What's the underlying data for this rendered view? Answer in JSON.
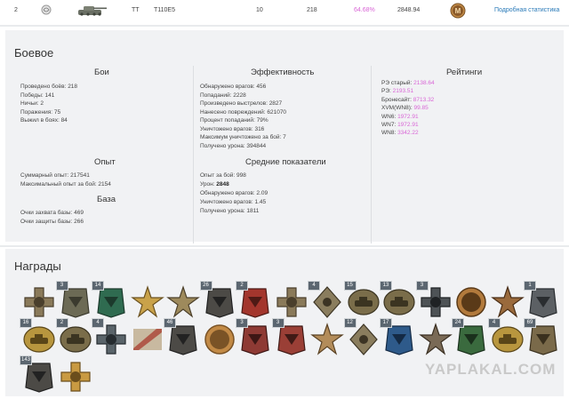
{
  "vehicle_row": {
    "index": "2",
    "tank_class": "ТТ",
    "tank_name": "T110E5",
    "level": "10",
    "battles": "218",
    "win_percent": "64.68%",
    "rating": "2848.94",
    "link_label": "Подробная статистика",
    "colors": {
      "win_percent": "#d966d6",
      "link": "#2a7ab8"
    }
  },
  "stats": {
    "title": "Боевое",
    "battles": {
      "heading": "Бои",
      "lines": [
        "Проведено боёв: 218",
        "Победы: 141",
        "Ничьи: 2",
        "Поражения: 75",
        "Выжил в боях: 84"
      ]
    },
    "efficiency": {
      "heading": "Эффективность",
      "lines": [
        "Обнаружено врагов: 456",
        "Попаданий: 2228",
        "Произведено выстрелов: 2827",
        "Нанесено повреждений: 621070",
        "Процент попаданий: 79%",
        "Уничтожено врагов: 316",
        "Максимум уничтожено за бой: 7",
        "Получено урона: 394844"
      ]
    },
    "ratings": {
      "heading": "Рейтинги",
      "items": [
        {
          "label": "РЭ старый:",
          "value": "2138.64"
        },
        {
          "label": "РЭ:",
          "value": "2193.51"
        },
        {
          "label": "Бронесайт:",
          "value": "8713.32"
        },
        {
          "label": "XVM(WN8):",
          "value": "99.85"
        },
        {
          "label": "WN6:",
          "value": "1972.91"
        },
        {
          "label": "WN7:",
          "value": "1972.91"
        },
        {
          "label": "WN8:",
          "value": "3342.22"
        }
      ],
      "value_color": "#d966d6"
    },
    "experience": {
      "heading": "Опыт",
      "lines": [
        "Суммарный опыт: 217541",
        "Максимальный опыт за бой: 2154"
      ]
    },
    "averages": {
      "heading": "Средние показатели",
      "exp": "Опыт за бой: 998",
      "damage_label": "Урон:",
      "damage_value": "2848",
      "lines": [
        "Обнаружено врагов: 2.09",
        "Уничтожено врагов: 1.45",
        "Получено урона: 1811"
      ]
    },
    "base": {
      "heading": "База",
      "lines": [
        "Очки захвата базы: 469",
        "Очки защиты базы: 266"
      ]
    }
  },
  "awards": {
    "title": "Награды",
    "items": [
      {
        "icon": "cross-medal-icon",
        "count": ""
      },
      {
        "icon": "chevron-badge-icon",
        "count": "3"
      },
      {
        "icon": "green-shield-icon",
        "count": "14"
      },
      {
        "icon": "gold-star-medal-icon",
        "count": ""
      },
      {
        "icon": "star-portrait-medal-icon",
        "count": ""
      },
      {
        "icon": "dark-badge-icon",
        "count": "26"
      },
      {
        "icon": "red-plaque-icon",
        "count": "2"
      },
      {
        "icon": "cross-medal-icon",
        "count": ""
      },
      {
        "icon": "diamond-badge-icon",
        "count": "4"
      },
      {
        "icon": "tank-emblem-icon",
        "count": "15"
      },
      {
        "icon": "tank-emblem-icon",
        "count": "13"
      },
      {
        "icon": "cross-swords-icon",
        "count": "3"
      },
      {
        "icon": "portrait-medal-icon",
        "count": ""
      },
      {
        "icon": "star-medal-icon",
        "count": ""
      },
      {
        "icon": "tank-badge-icon",
        "count": "1"
      },
      {
        "icon": "wreath-tank-icon",
        "count": "16"
      },
      {
        "icon": "tank-emblem-icon",
        "count": "2"
      },
      {
        "icon": "cross-wreath-icon",
        "count": "4"
      },
      {
        "icon": "ribbon-icon",
        "count": ""
      },
      {
        "icon": "dark-badge-icon",
        "count": "46"
      },
      {
        "icon": "mastery-m-icon",
        "count": ""
      },
      {
        "icon": "red-tank-badge-icon",
        "count": "3"
      },
      {
        "icon": "red-badge-icon",
        "count": "3"
      },
      {
        "icon": "diamond-star-icon",
        "count": ""
      },
      {
        "icon": "diamond-badge-icon",
        "count": "12"
      },
      {
        "icon": "blue-plaque-icon",
        "count": "17"
      },
      {
        "icon": "red-star-icon",
        "count": ""
      },
      {
        "icon": "green-tank-badge-icon",
        "count": "24"
      },
      {
        "icon": "wreath-tank-icon",
        "count": "4"
      },
      {
        "icon": "small-badge-icon",
        "count": "69"
      },
      {
        "icon": "dark-badge-icon",
        "count": "143"
      },
      {
        "icon": "gold-cross-icon",
        "count": ""
      }
    ]
  },
  "watermark": "YAPLAKAL.COM",
  "mastery_letter": "M"
}
